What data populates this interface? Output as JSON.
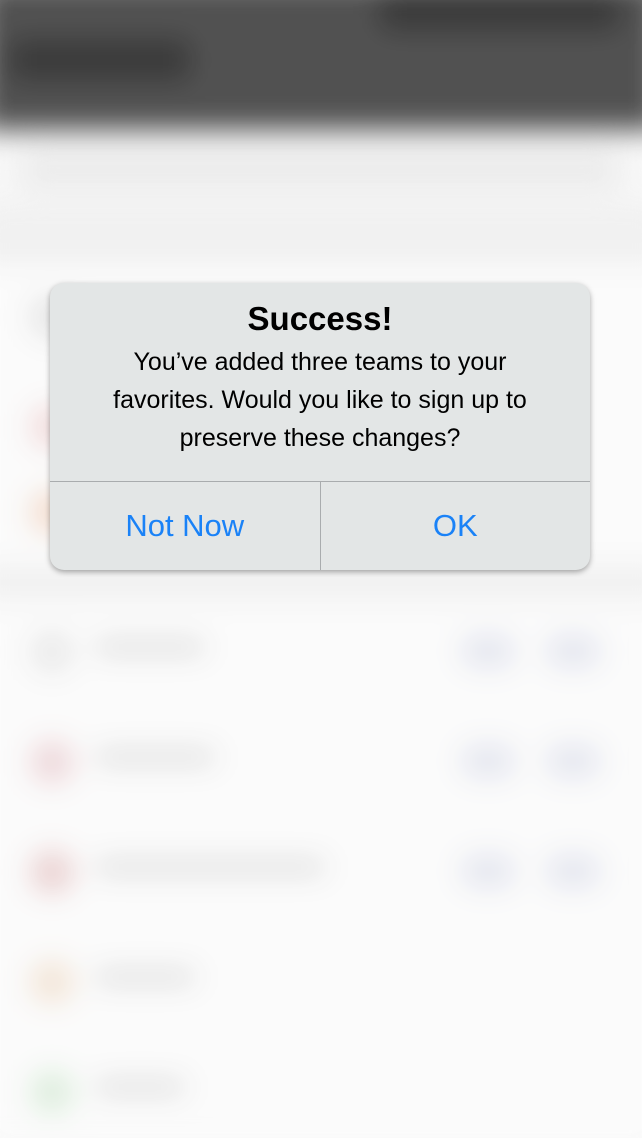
{
  "alert": {
    "title": "Success!",
    "message": "You’ve added three teams to your favorites. Would you like to sign up to preserve these changes?",
    "buttons": {
      "not_now": "Not Now",
      "ok": "OK"
    }
  },
  "colors": {
    "button_text": "#1a82f7",
    "alert_background": "#e3e6e6",
    "header_background": "#3a3a3a"
  }
}
